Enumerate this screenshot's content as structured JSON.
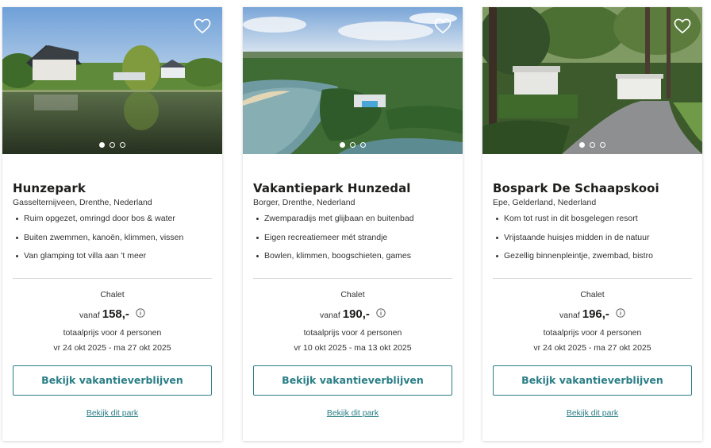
{
  "cards": [
    {
      "title": "Hunzepark",
      "location": "Gasselternijveen, Drenthe, Nederland",
      "features": [
        "Ruim opgezet, omringd door bos & water",
        "Buiten zwemmen, kanoën, klimmen, vissen",
        "Van glamping tot villa aan 't meer"
      ],
      "type": "Chalet",
      "vanaf": "vanaf",
      "price": "158,-",
      "total": "totaalprijs voor 4 personen",
      "dates": "vr 24 okt 2025 - ma 27 okt 2025",
      "button": "Bekijk vakantieverblijven",
      "link": "Bekijk dit park"
    },
    {
      "title": "Vakantiepark Hunzedal",
      "location": "Borger, Drenthe, Nederland",
      "features": [
        "Zwemparadijs met glijbaan en buitenbad",
        "Eigen recreatiemeer mét strandje",
        "Bowlen, klimmen, boogschieten, games"
      ],
      "type": "Chalet",
      "vanaf": "vanaf",
      "price": "190,-",
      "total": "totaalprijs voor 4 personen",
      "dates": "vr 10 okt 2025 - ma 13 okt 2025",
      "button": "Bekijk vakantieverblijven",
      "link": "Bekijk dit park"
    },
    {
      "title": "Bospark De Schaapskooi",
      "location": "Epe, Gelderland, Nederland",
      "features": [
        "Kom tot rust in dit bosgelegen resort",
        "Vrijstaande huisjes midden in de natuur",
        "Gezellig binnenpleintje, zwembad, bistro"
      ],
      "type": "Chalet",
      "vanaf": "vanaf",
      "price": "196,-",
      "total": "totaalprijs voor 4 personen",
      "dates": "vr 24 okt 2025 - ma 27 okt 2025",
      "button": "Bekijk vakantieverblijven",
      "link": "Bekijk dit park"
    }
  ],
  "colors": {
    "accent": "#2a7e86",
    "divider": "#d9d9d9",
    "text": "#1d1d1b"
  },
  "icons": {
    "favorite": "heart-icon",
    "info": "info-icon",
    "carousel": "carousel-dot"
  },
  "carousel": {
    "slides": 3,
    "active": 1
  }
}
